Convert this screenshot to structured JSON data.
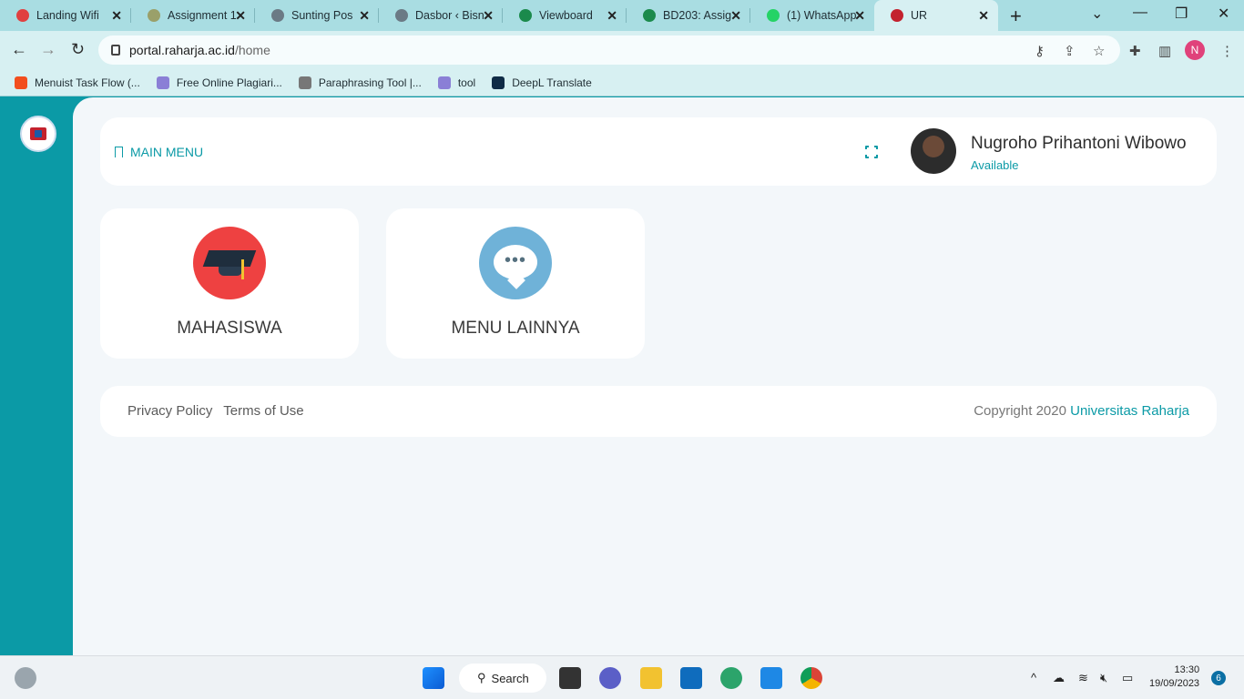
{
  "browser": {
    "tabs": [
      {
        "label": "Landing Wifi",
        "color": "#e04040"
      },
      {
        "label": "Assignment 1",
        "color": "#9aa06a"
      },
      {
        "label": "Sunting Pos",
        "color": "#6b7a85"
      },
      {
        "label": "Dasbor ‹ Bisn",
        "color": "#6b7a85"
      },
      {
        "label": "Viewboard",
        "color": "#1b8a4c"
      },
      {
        "label": "BD203: Assig",
        "color": "#1b8a4c"
      },
      {
        "label": "(1) WhatsApp",
        "color": "#25d366"
      },
      {
        "label": "UR",
        "color": "#c3222e"
      }
    ],
    "url_host": "portal.raharja.ac.id",
    "url_path": "/home",
    "profile_initial": "N",
    "bookmarks": [
      {
        "label": "Menuist Task Flow (...",
        "color": "#f24e1e"
      },
      {
        "label": "Free Online Plagiari...",
        "color": "#8a7fd6"
      },
      {
        "label": "Paraphrasing Tool |...",
        "color": "#777777"
      },
      {
        "label": "tool",
        "color": "#8a7fd6"
      },
      {
        "label": "DeepL Translate",
        "color": "#0f2b46"
      }
    ]
  },
  "portal": {
    "main_menu_label": "MAIN MENU",
    "user": {
      "name": "Nugroho Prihantoni Wibowo",
      "status": "Available"
    },
    "cards": [
      {
        "label": "MAHASISWA",
        "icon": "graduation-cap-icon",
        "color": "#ee4141"
      },
      {
        "label": "MENU LAINNYA",
        "icon": "chat-bubble-icon",
        "color": "#6fb2d8"
      }
    ],
    "footer": {
      "privacy": "Privacy Policy",
      "terms": "Terms of Use",
      "copyright_prefix": "Copyright 2020",
      "brand": "Universitas Raharja"
    }
  },
  "taskbar": {
    "search_label": "Search",
    "time": "13:30",
    "date": "19/09/2023",
    "notification_count": "6"
  },
  "colors": {
    "accent": "#0b9aa6",
    "chrome": "#d7f0f2"
  }
}
